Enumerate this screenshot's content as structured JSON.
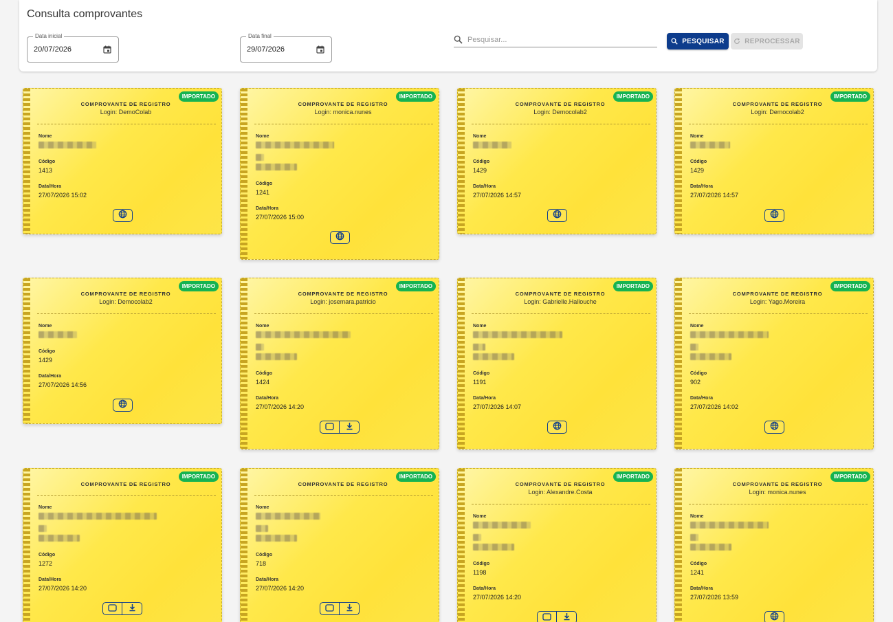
{
  "header": {
    "title": "Consulta comprovantes",
    "start_date": {
      "label": "Data inicial",
      "value": "20/07/2026"
    },
    "end_date": {
      "label": "Data final",
      "value": "29/07/2026"
    },
    "search": {
      "placeholder": "Pesquisar...",
      "value": ""
    },
    "search_button": "PESQUISAR",
    "reprocess_button": "REPROCESSAR"
  },
  "card_labels": {
    "title": "COMPROVANTE DE REGISTRO",
    "badge": "IMPORTADO",
    "name": "Nome",
    "code": "Código",
    "datetime": "Data/Hora"
  },
  "cards": [
    {
      "login": "Login: DemoColab",
      "code": "1413",
      "datetime": "27/07/2026 15:02",
      "actions": [
        "globe-icon"
      ]
    },
    {
      "login": "Login: monica.nunes",
      "code": "1241",
      "datetime": "27/07/2026 15:00",
      "actions": [
        "globe-icon"
      ]
    },
    {
      "login": "Login: Democolab2",
      "code": "1429",
      "datetime": "27/07/2026 14:57",
      "actions": [
        "globe-icon"
      ]
    },
    {
      "login": "Login: Democolab2",
      "code": "1429",
      "datetime": "27/07/2026 14:57",
      "actions": [
        "globe-icon"
      ]
    },
    {
      "login": "Login: Democolab2",
      "code": "1429",
      "datetime": "27/07/2026 14:56",
      "actions": [
        "globe-icon"
      ]
    },
    {
      "login": "Login: josemara.patricio",
      "code": "1424",
      "datetime": "27/07/2026 14:20",
      "actions": [
        "tablet-icon",
        "download-icon"
      ]
    },
    {
      "login": "Login: Gabrielle.Hallouche",
      "code": "1191",
      "datetime": "27/07/2026 14:07",
      "actions": [
        "globe-icon"
      ]
    },
    {
      "login": "Login: Yago.Moreira",
      "code": "902",
      "datetime": "27/07/2026 14:02",
      "actions": [
        "globe-icon"
      ]
    },
    {
      "login": "",
      "code": "1272",
      "datetime": "27/07/2026 14:20",
      "actions": [
        "tablet-icon",
        "download-icon"
      ]
    },
    {
      "login": "",
      "code": "718",
      "datetime": "27/07/2026 14:20",
      "actions": [
        "tablet-icon",
        "download-icon"
      ]
    },
    {
      "login": "Login: Alexandre.Costa",
      "code": "1198",
      "datetime": "27/07/2026 14:20",
      "actions": [
        "tablet-icon",
        "download-icon"
      ]
    },
    {
      "login": "Login: monica.nunes",
      "code": "1241",
      "datetime": "27/07/2026 13:59",
      "actions": [
        "globe-icon"
      ]
    }
  ],
  "colors": {
    "primary": "#0d3c8c",
    "badge": "#16b351",
    "card_yellow": "#ffe84a"
  }
}
